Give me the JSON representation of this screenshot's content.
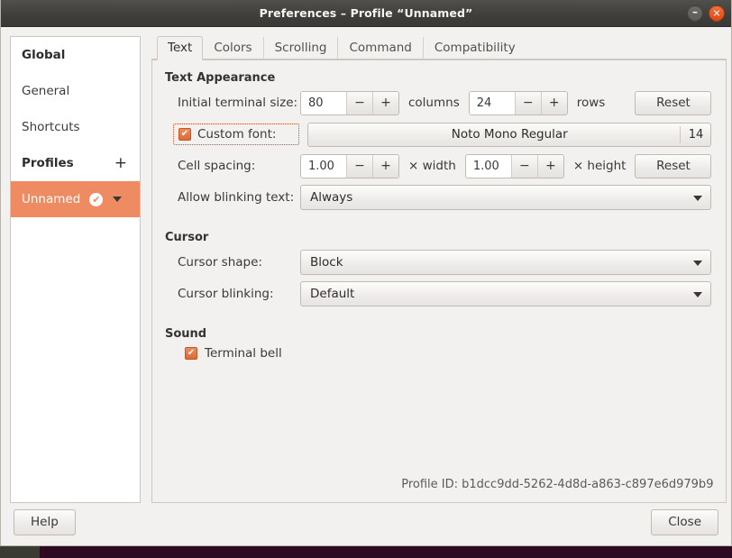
{
  "window": {
    "title": "Preferences – Profile “Unnamed”",
    "minimize_icon": "minimize-icon",
    "minimize_glyph": "–",
    "close_icon": "close-icon",
    "close_glyph": "✕"
  },
  "sidebar": {
    "items": [
      {
        "label": "Global",
        "type": "header"
      },
      {
        "label": "General",
        "type": "item"
      },
      {
        "label": "Shortcuts",
        "type": "item"
      },
      {
        "label": "Profiles",
        "type": "header",
        "add_label": "+"
      },
      {
        "label": "Unnamed",
        "type": "profile",
        "selected": true,
        "check_glyph": "✔"
      }
    ]
  },
  "tabs": [
    {
      "label": "Text",
      "active": true
    },
    {
      "label": "Colors",
      "active": false
    },
    {
      "label": "Scrolling",
      "active": false
    },
    {
      "label": "Command",
      "active": false
    },
    {
      "label": "Compatibility",
      "active": false
    }
  ],
  "text_appearance": {
    "heading": "Text Appearance",
    "terminal_size": {
      "label": "Initial terminal size:",
      "columns_value": "80",
      "columns_unit": "columns",
      "rows_value": "24",
      "rows_unit": "rows",
      "minus": "−",
      "plus": "+",
      "reset_label": "Reset"
    },
    "custom_font": {
      "label": "Custom font:",
      "checked_glyph": "✔",
      "font_name": "Noto Mono Regular",
      "font_size": "14"
    },
    "cell_spacing": {
      "label": "Cell spacing:",
      "width_value": "1.00",
      "width_unit": "× width",
      "height_value": "1.00",
      "height_unit": "× height",
      "minus": "−",
      "plus": "+",
      "reset_label": "Reset"
    },
    "blinking": {
      "label": "Allow blinking text:",
      "value": "Always"
    }
  },
  "cursor": {
    "heading": "Cursor",
    "shape": {
      "label": "Cursor shape:",
      "value": "Block"
    },
    "blinking": {
      "label": "Cursor blinking:",
      "value": "Default"
    }
  },
  "sound": {
    "heading": "Sound",
    "terminal_bell": {
      "label": "Terminal bell",
      "checked_glyph": "✔"
    }
  },
  "profile_id": {
    "label": "Profile ID:",
    "value": "b1dcc9dd-5262-4d8d-a863-c897e6d979b9"
  },
  "footer": {
    "help_label": "Help",
    "close_label": "Close"
  },
  "colors": {
    "accent": "#ef8b63",
    "close_button": "#dd4814",
    "titlebar": "#3f3e3b",
    "window_bg": "#f2f1f0"
  }
}
